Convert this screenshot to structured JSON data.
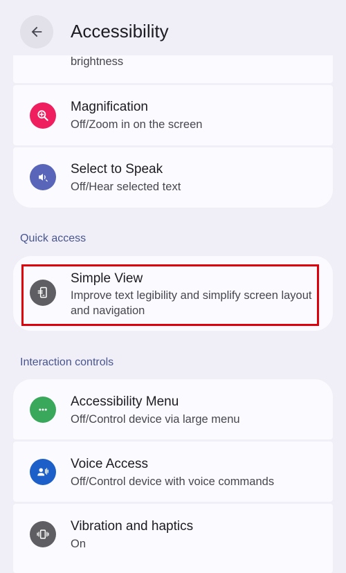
{
  "header": {
    "title": "Accessibility"
  },
  "items": {
    "brightness": {
      "subtitle": "brightness"
    },
    "magnification": {
      "title": "Magnification",
      "subtitle": "Off/Zoom in on the screen",
      "icon": "magnify-plus-icon",
      "color": "#ef1f5f"
    },
    "select_to_speak": {
      "title": "Select to Speak",
      "subtitle": "Off/Hear selected text",
      "icon": "speaker-icon",
      "color": "#5865b8"
    },
    "simple_view": {
      "title": "Simple View",
      "subtitle": "Improve text legibility and simplify screen layout and navigation",
      "icon": "phone-screen-icon",
      "color": "#5f5f63"
    },
    "accessibility_menu": {
      "title": "Accessibility Menu",
      "subtitle": "Off/Control device via large menu",
      "icon": "dots-menu-icon",
      "color": "#3aa85a"
    },
    "voice_access": {
      "title": "Voice Access",
      "subtitle": "Off/Control device with voice commands",
      "icon": "voice-person-icon",
      "color": "#1c5fc9"
    },
    "vibration": {
      "title": "Vibration and haptics",
      "subtitle": "On",
      "icon": "vibration-icon",
      "color": "#5f5f63"
    }
  },
  "sections": {
    "quick_access": "Quick access",
    "interaction_controls": "Interaction controls"
  }
}
